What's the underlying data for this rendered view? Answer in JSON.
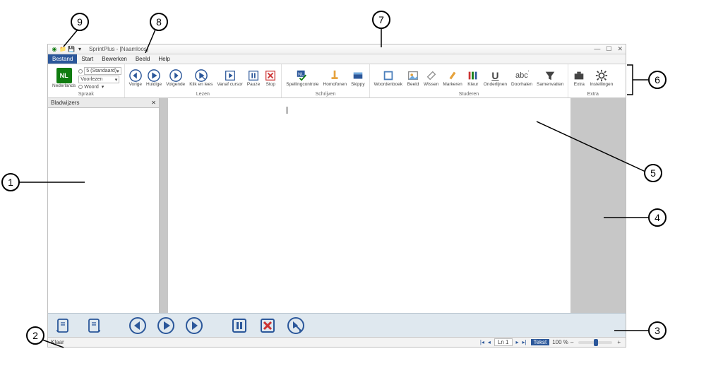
{
  "window": {
    "title": "SprintPlus - [Naamloos]",
    "qat_dropdown": "▾"
  },
  "menus": {
    "file": "Bestand",
    "start": "Start",
    "edit": "Bewerken",
    "view": "Beeld",
    "help": "Help"
  },
  "ribbon": {
    "groups": {
      "speech": "Spraak",
      "read": "Lezen",
      "write": "Schrijven",
      "study": "Studeren",
      "extra": "Extra"
    },
    "lang_badge": "NL",
    "lang_label": "Nederlands",
    "speech_speed": "5 (Standaard)",
    "speech_mode": "Voorlezen",
    "speech_unit": "Woord",
    "read": {
      "prev": "Vorige",
      "current": "Huidige",
      "next": "Volgende",
      "click": "Klik en lees",
      "cursor": "Vanaf cursor",
      "pause": "Pauze",
      "stop": "Stop"
    },
    "write": {
      "spell": "Spellingcontrole",
      "homophones": "Homofonen",
      "skippy": "Skippy"
    },
    "study": {
      "dict": "Woordenboek",
      "picture": "Beeld",
      "erase": "Wissen",
      "mark": "Markeren",
      "color": "Kleur",
      "underline": "Onderlijnen",
      "strike": "Doorhalen",
      "summarize": "Samenvatten"
    },
    "extra": {
      "extra": "Extra",
      "settings": "Instellingen"
    }
  },
  "sidebar": {
    "title": "Bladwijzers"
  },
  "status": {
    "ready": "Klaar",
    "line_label": "Ln 1",
    "mode": "Tekst",
    "zoom": "100 %"
  },
  "callouts": {
    "1": "1",
    "2": "2",
    "3": "3",
    "4": "4",
    "5": "5",
    "6": "6",
    "7": "7",
    "8": "8",
    "9": "9"
  }
}
